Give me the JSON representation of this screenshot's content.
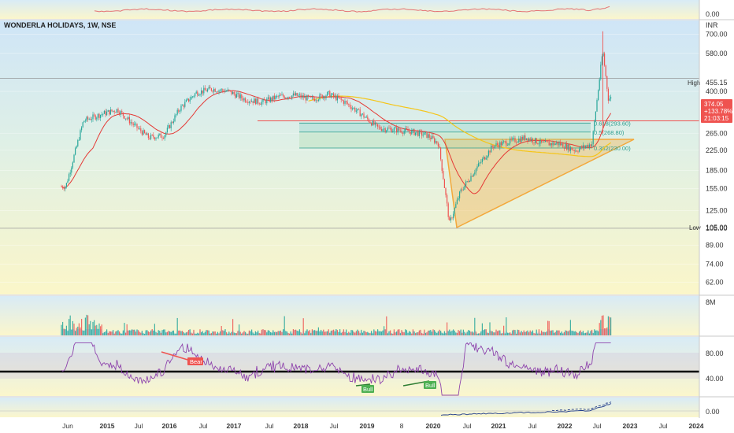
{
  "symbol_title": "WONDERLA HOLIDAYS, 1W, NSE",
  "currency": "INR",
  "top_pane": {
    "value_label": "0.00"
  },
  "price_pane": {
    "scale": "log",
    "ylim": [
      55,
      800
    ],
    "tick_labels": [
      {
        "v": 700,
        "t": "700.00"
      },
      {
        "v": 580,
        "t": "580.00"
      },
      {
        "v": 400,
        "t": "400.00"
      },
      {
        "v": 265,
        "t": "265.00"
      },
      {
        "v": 225,
        "t": "225.00"
      },
      {
        "v": 185,
        "t": "185.00"
      },
      {
        "v": 155,
        "t": "155.00"
      },
      {
        "v": 125,
        "t": "125.00"
      },
      {
        "v": 105,
        "t": "105.00"
      },
      {
        "v": 89,
        "t": "89.00"
      },
      {
        "v": 74,
        "t": "74.00"
      },
      {
        "v": 62,
        "t": "62.00"
      }
    ],
    "high": {
      "label": "High",
      "value": "455.15"
    },
    "low": {
      "label": "Low",
      "value": "105.00"
    },
    "last_price": {
      "price": "374.05",
      "change": "+133.78%",
      "countdown": "21:03:15"
    },
    "fib_levels": [
      {
        "ratio": "0.618",
        "value": 293.6,
        "text": "0.618(293.60)"
      },
      {
        "ratio": "0.5",
        "value": 268.8,
        "text": "0.5(268.80)"
      },
      {
        "ratio": "0.382",
        "value": 230.0,
        "text": "0.382(230.00)"
      }
    ],
    "resistance_level": 300,
    "colors": {
      "up": "#26a69a",
      "down": "#ef5350",
      "ma": "#e53935",
      "ma_long": "#f5c518",
      "triangle": "#f3a83b"
    }
  },
  "volume_pane": {
    "label": "8M"
  },
  "rsi_pane": {
    "labels": [
      "80.00",
      "40.00"
    ],
    "annotations": [
      {
        "text": "Bear",
        "kind": "bear"
      },
      {
        "text": "Bull",
        "kind": "bull"
      },
      {
        "text": "Bull",
        "kind": "bull"
      }
    ]
  },
  "bottom_pane": {
    "label": "0.00"
  },
  "x_axis": [
    "Jun",
    "2015",
    "Jul",
    "2016",
    "Jul",
    "2017",
    "Jul",
    "2018",
    "Jul",
    "2019",
    "8",
    "2020",
    "Jul",
    "2021",
    "Jul",
    "2022",
    "Jul",
    "2023",
    "Jul",
    "2024"
  ],
  "chart_data": {
    "type": "candlestick",
    "title": "WONDERLA HOLIDAYS, 1W, NSE",
    "currency": "INR",
    "y_scale": "log",
    "ylim": [
      55,
      800
    ],
    "x_range": [
      "2014-05",
      "2024-01"
    ],
    "series": [
      {
        "name": "",
        "x": [
          "2014-06",
          "2014-09",
          "2014-12",
          "2015-03",
          "2015-06",
          "2015-09",
          "2015-12",
          "2016-03",
          "2016-06",
          "2016-09",
          "2016-12",
          "2017-03",
          "2017-06",
          "2017-09",
          "2017-12",
          "2018-03",
          "2018-06",
          "2018-09",
          "2018-12",
          "2019-03",
          "2019-06",
          "2019-09",
          "2019-12",
          "2020-02",
          "2020-04",
          "2020-06",
          "2020-09",
          "2020-12",
          "2021-03",
          "2021-06",
          "2021-09",
          "2021-12",
          "2022-03",
          "2022-06",
          "2022-08",
          "2022-09"
        ],
        "values": [
          158,
          300,
          320,
          335,
          290,
          255,
          260,
          340,
          395,
          410,
          400,
          370,
          360,
          380,
          385,
          370,
          390,
          360,
          320,
          280,
          275,
          270,
          260,
          240,
          110,
          150,
          190,
          235,
          245,
          255,
          240,
          240,
          225,
          240,
          600,
          374
        ]
      }
    ],
    "levels": {
      "high": 455.15,
      "low": 105.0,
      "last": 374.05
    },
    "fibonacci": [
      {
        "ratio": 0.618,
        "value": 293.6
      },
      {
        "ratio": 0.5,
        "value": 268.8
      },
      {
        "ratio": 0.382,
        "value": 230.0
      }
    ]
  }
}
